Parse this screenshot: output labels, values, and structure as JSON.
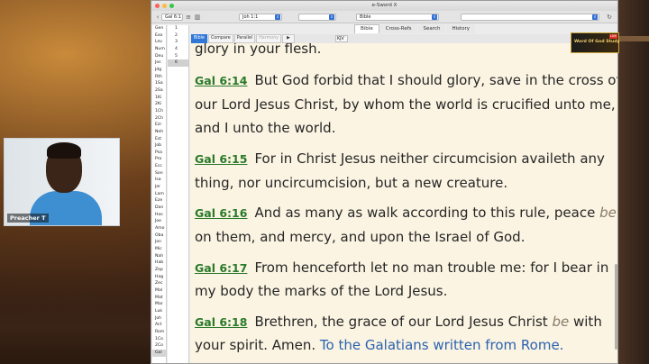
{
  "window": {
    "title": "e-Sword X"
  },
  "toolbar": {
    "reference_input": "Gal 6:1",
    "nav_reference": "Joh 1:1",
    "module_select": "Bible"
  },
  "top_tabs": [
    {
      "label": "Bible",
      "active": true
    },
    {
      "label": "Cross-Refs",
      "active": false
    },
    {
      "label": "Search",
      "active": false
    },
    {
      "label": "History",
      "active": false
    }
  ],
  "books": [
    "Gen",
    "Exo",
    "Lev",
    "Num",
    "Deu",
    "Jos",
    "Jdg",
    "Rth",
    "1Sa",
    "2Sa",
    "1Ki",
    "2Ki",
    "1Ch",
    "2Ch",
    "Ezr",
    "Neh",
    "Est",
    "Job",
    "Psa",
    "Pro",
    "Ecc",
    "Son",
    "Isa",
    "Jer",
    "Lam",
    "Eze",
    "Dan",
    "Hos",
    "Joe",
    "Amo",
    "Oba",
    "Jon",
    "Mic",
    "Nah",
    "Hab",
    "Zep",
    "Hag",
    "Zec",
    "Mal",
    "Mat",
    "Mar",
    "Luk",
    "Joh",
    "Act",
    "Rom",
    "1Co",
    "2Co",
    "Gal"
  ],
  "selected_book": "Gal",
  "chapters": [
    "1",
    "2",
    "3",
    "4",
    "5",
    "6"
  ],
  "selected_chapter": "6",
  "bible_tabs": [
    {
      "label": "Bible",
      "state": "active"
    },
    {
      "label": "Compare",
      "state": "normal"
    },
    {
      "label": "Parallel",
      "state": "normal"
    },
    {
      "label": "Harmony",
      "state": "disabled"
    },
    {
      "label": "▶",
      "state": "play"
    }
  ],
  "version": "KJV",
  "verses_text": {
    "partial_line": "glory in your flesh.",
    "v14_ref": "Gal 6:14",
    "v14_l1": "But God forbid that I should glory, save in the cross of",
    "v14_l2": "our Lord Jesus Christ, by whom the world is crucified unto me,",
    "v14_l3": "and I unto the world.",
    "v15_ref": "Gal 6:15",
    "v15_l1": "For in Christ Jesus neither circumcision availeth any",
    "v15_l2": "thing, nor uncircumcision, but a new creature.",
    "v16_ref": "Gal 6:16",
    "v16_l1": "And as many as walk according to this rule, peace",
    "v16_l1_italic": "be",
    "v16_l2": "on them, and mercy, and upon the Israel of God.",
    "v17_ref": "Gal 6:17",
    "v17_l1": "From henceforth let no man trouble me: for I bear in",
    "v17_l2": "my body the marks of the Lord Jesus.",
    "v18_ref": "Gal 6:18",
    "v18_l1a": "Brethren, the grace of our Lord Jesus Christ",
    "v18_l1_italic": "be",
    "v18_l1b": "with",
    "v18_l2": "your spirit. Amen.",
    "v18_subscript": "To the Galatians written from Rome."
  },
  "webcam": {
    "name": "Preacher T"
  },
  "logo": {
    "text": "Word Of God Study",
    "badge": "LIVE"
  },
  "colors": {
    "verse_ref": "#2a7a2a",
    "reader_bg": "#fbf4e2",
    "subscript": "#2a62b0",
    "italic_word": "#8a7a66",
    "active_tab": "#2f78d8"
  }
}
